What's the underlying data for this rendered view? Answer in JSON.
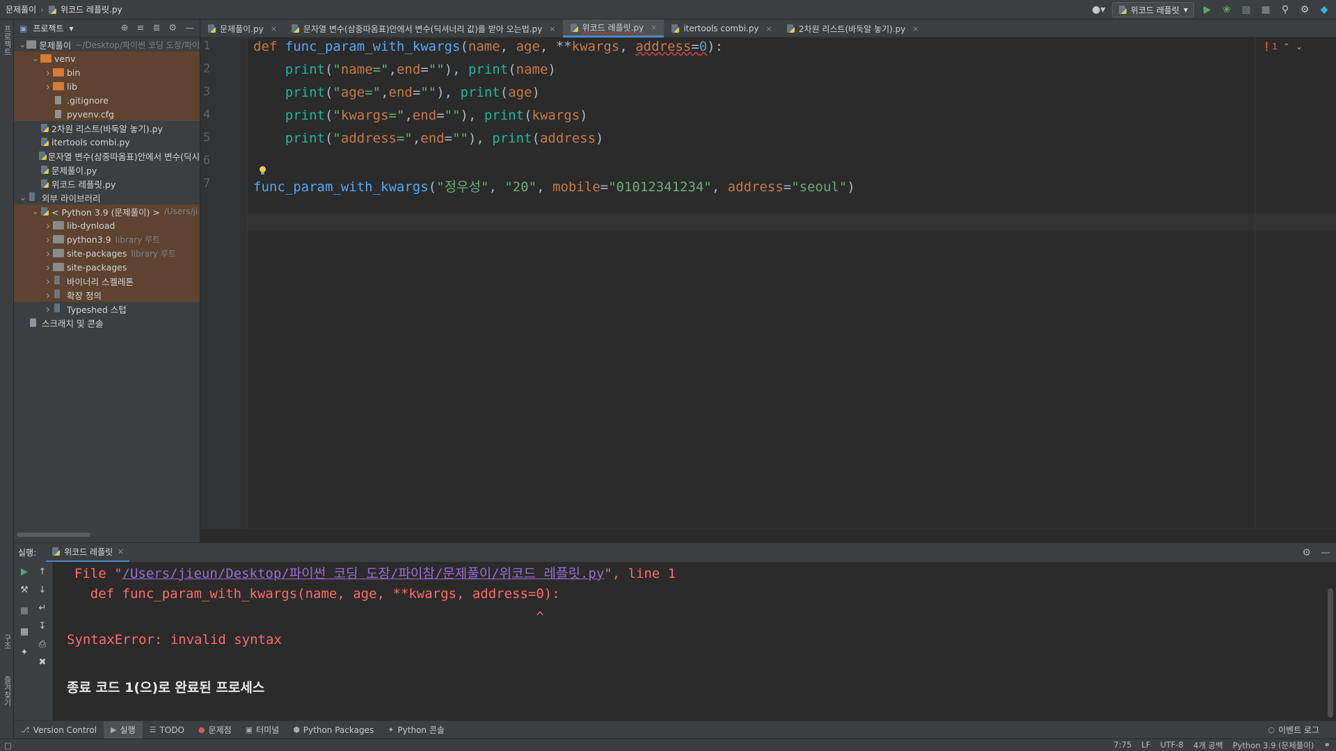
{
  "breadcrumb": {
    "project": "문제풀이",
    "file": "위코드 레플릿.py"
  },
  "toolbar": {
    "run_config": "위코드 레플릿"
  },
  "left_stripe": {
    "project_label": "프로젝트",
    "structure_label": "구조",
    "favorites_label": "즐겨찾기"
  },
  "project_panel": {
    "title": "프로젝트",
    "tree": [
      {
        "indent": 0,
        "arrow": "open",
        "icon": "folder-dark",
        "label": "문제풀이",
        "hint": "~/Desktop/파이썬 코딩 도장/파이",
        "excluded": false
      },
      {
        "indent": 1,
        "arrow": "open",
        "icon": "folder-orange",
        "label": "venv",
        "hint": "",
        "excluded": true
      },
      {
        "indent": 2,
        "arrow": "closed",
        "icon": "folder-orange",
        "label": "bin",
        "hint": "",
        "excluded": true
      },
      {
        "indent": 2,
        "arrow": "closed",
        "icon": "folder-orange",
        "label": "lib",
        "hint": "",
        "excluded": true
      },
      {
        "indent": 2,
        "arrow": "none",
        "icon": "file",
        "label": ".gitignore",
        "hint": "",
        "excluded": true
      },
      {
        "indent": 2,
        "arrow": "none",
        "icon": "file",
        "label": "pyvenv.cfg",
        "hint": "",
        "excluded": true
      },
      {
        "indent": 1,
        "arrow": "none",
        "icon": "py",
        "label": "2차원 리스트(바둑알 놓기).py",
        "hint": "",
        "excluded": false
      },
      {
        "indent": 1,
        "arrow": "none",
        "icon": "py",
        "label": "itertools combi.py",
        "hint": "",
        "excluded": false
      },
      {
        "indent": 1,
        "arrow": "none",
        "icon": "py",
        "label": "문자열 변수(삼중따옴표)안에서 변수(딕시",
        "hint": "",
        "excluded": false
      },
      {
        "indent": 1,
        "arrow": "none",
        "icon": "py",
        "label": "문제풀이.py",
        "hint": "",
        "excluded": false
      },
      {
        "indent": 1,
        "arrow": "none",
        "icon": "py",
        "label": "위코드 레플릿.py",
        "hint": "",
        "excluded": false
      },
      {
        "indent": 0,
        "arrow": "open",
        "icon": "lib",
        "label": "외부 라이브러리",
        "hint": "",
        "excluded": false
      },
      {
        "indent": 1,
        "arrow": "open",
        "icon": "py",
        "label": "< Python 3.9 (문제풀이) >",
        "hint": "/Users/ji",
        "excluded": true
      },
      {
        "indent": 2,
        "arrow": "closed",
        "icon": "folder-dark",
        "label": "lib-dynload",
        "hint": "",
        "excluded": true
      },
      {
        "indent": 2,
        "arrow": "closed",
        "icon": "folder-dark",
        "label": "python3.9",
        "hint": "library 루트",
        "excluded": true
      },
      {
        "indent": 2,
        "arrow": "closed",
        "icon": "folder-dark",
        "label": "site-packages",
        "hint": "library 루트",
        "excluded": true
      },
      {
        "indent": 2,
        "arrow": "closed",
        "icon": "folder-dark",
        "label": "site-packages",
        "hint": "",
        "excluded": true
      },
      {
        "indent": 2,
        "arrow": "closed",
        "icon": "lib",
        "label": "바이너리 스켈레톤",
        "hint": "",
        "excluded": true
      },
      {
        "indent": 2,
        "arrow": "closed",
        "icon": "lib",
        "label": "확장 정의",
        "hint": "",
        "excluded": true
      },
      {
        "indent": 2,
        "arrow": "closed",
        "icon": "lib",
        "label": "Typeshed 스텁",
        "hint": "",
        "excluded": false
      },
      {
        "indent": 0,
        "arrow": "none",
        "icon": "scratch",
        "label": "스크래치 및 콘솔",
        "hint": "",
        "excluded": false
      }
    ]
  },
  "tabs": [
    {
      "label": "문제풀이.py",
      "active": false
    },
    {
      "label": "문자열 변수(삼중따옴표)안에서 변수(딕셔너리 값)를 받아 오는법.py",
      "active": false
    },
    {
      "label": "위코드 레플릿.py",
      "active": true
    },
    {
      "label": "itertools combi.py",
      "active": false
    },
    {
      "label": "2차원 리스트(바둑알 놓기).py",
      "active": false
    }
  ],
  "editor": {
    "error_count": "1",
    "line_numbers": [
      "1",
      "2",
      "3",
      "4",
      "5",
      "6",
      "7"
    ],
    "lines": [
      "def func_param_with_kwargs(name, age, **kwargs, address=0):",
      "    print(\"name=\",end=\"\"), print(name)",
      "    print(\"age=\",end=\"\"), print(age)",
      "    print(\"kwargs=\",end=\"\"), print(kwargs)",
      "    print(\"address=\",end=\"\"), print(address)",
      "",
      "func_param_with_kwargs(\"정우성\", \"20\", mobile=\"01012341234\", address=\"seoul\")"
    ]
  },
  "run_panel": {
    "label": "실행:",
    "tab": "위코드 레플릿",
    "console": {
      "file_prefix": "  File \"",
      "file_path": "/Users/jieun/Desktop/파이썬 코딩 도장/파이참/문제풀이/위코드 레플릿.py",
      "file_suffix": "\", line 1",
      "code_line": "    def func_param_with_kwargs(name, age, **kwargs, address=0):",
      "caret_line": "                                                            ^",
      "error": "SyntaxError: invalid syntax",
      "exit_message": "종료 코드 1(으)로 완료된 프로세스"
    }
  },
  "bottom_tools": [
    {
      "label": "Version Control",
      "icon": "branch-icon",
      "active": false
    },
    {
      "label": "실행",
      "icon": "run-icon",
      "active": true
    },
    {
      "label": "TODO",
      "icon": "list-icon",
      "active": false
    },
    {
      "label": "문제점",
      "icon": "error-icon",
      "active": false
    },
    {
      "label": "터미널",
      "icon": "terminal-icon",
      "active": false
    },
    {
      "label": "Python Packages",
      "icon": "packages-icon",
      "active": false
    },
    {
      "label": "Python 콘솔",
      "icon": "python-console-icon",
      "active": false
    }
  ],
  "event_log": "이벤트 로그",
  "status": {
    "position": "7:75",
    "line_sep": "LF",
    "encoding": "UTF-8",
    "indent": "4개 공백",
    "interpreter": "Python 3.9 (문제풀이)"
  }
}
